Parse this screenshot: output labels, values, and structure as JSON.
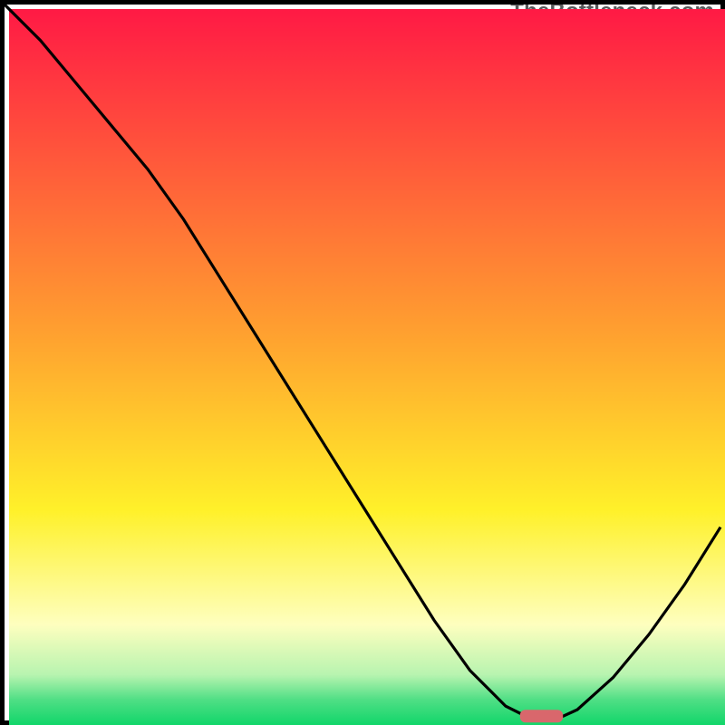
{
  "attribution": "TheBottleneck.com",
  "colors": {
    "red": "#ff1a45",
    "orange": "#ffa030",
    "yellow": "#fff12a",
    "paleyellow": "#feffbf",
    "green_mid": "#7ae88a",
    "green": "#12d66a",
    "frame": "#000000",
    "curve": "#000000",
    "marker": "#d9676c"
  },
  "chart_data": {
    "type": "line",
    "title": "",
    "xlabel": "",
    "ylabel": "",
    "xlim": [
      0,
      100
    ],
    "ylim": [
      0,
      100
    ],
    "x": [
      0,
      5,
      10,
      15,
      20,
      25,
      30,
      35,
      40,
      45,
      50,
      55,
      60,
      65,
      68,
      70,
      72,
      74,
      76,
      78,
      80,
      85,
      90,
      95,
      100
    ],
    "values": [
      100,
      95,
      89,
      83,
      77,
      70,
      62,
      54,
      46,
      38,
      30,
      22,
      14,
      7,
      4,
      2,
      1.0,
      0.5,
      0.4,
      0.6,
      1.5,
      6,
      12,
      19,
      27
    ],
    "marker": {
      "x_range": [
        72,
        78
      ],
      "y": 0.6,
      "color": "#d9676c"
    },
    "gradient_background": {
      "stops": [
        {
          "pos": 0.0,
          "color": "#ff1a45"
        },
        {
          "pos": 0.45,
          "color": "#ffa030"
        },
        {
          "pos": 0.7,
          "color": "#fff12a"
        },
        {
          "pos": 0.86,
          "color": "#feffbf"
        },
        {
          "pos": 0.93,
          "color": "#b8f4b0"
        },
        {
          "pos": 0.965,
          "color": "#4fdf85"
        },
        {
          "pos": 1.0,
          "color": "#12d66a"
        }
      ]
    }
  }
}
